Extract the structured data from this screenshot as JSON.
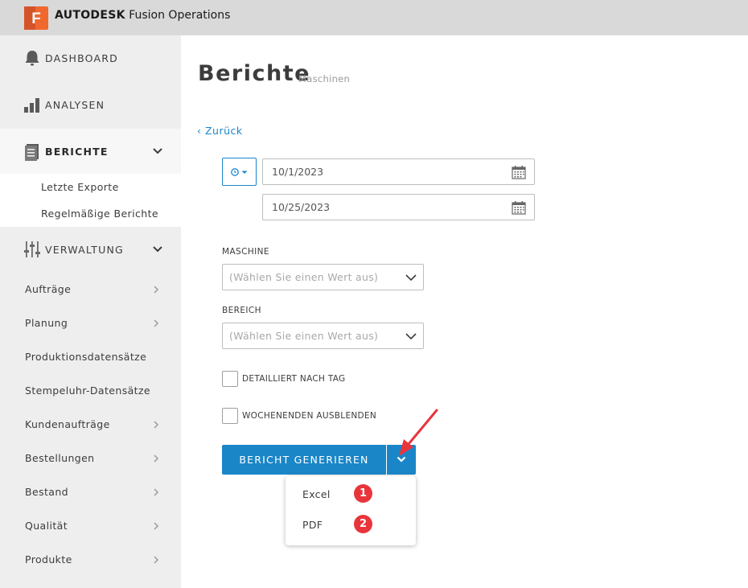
{
  "app": {
    "brand_bold": "AUTODESK",
    "brand_rest": " Fusion Operations",
    "logo_letter": "F",
    "accent_color": "#1a86c8",
    "logo_color": "#f0682d"
  },
  "sidebar": {
    "dashboard": "DASHBOARD",
    "analysen": "ANALYSEN",
    "berichte": "BERICHTE",
    "berichte_sub": [
      "Letzte Exporte",
      "Regelmäßige Berichte"
    ],
    "verwaltung": "VERWALTUNG",
    "verwaltung_items": [
      "Aufträge",
      "Planung",
      "Produktionsdatensätze",
      "Stempeluhr-Datensätze",
      "Kundenaufträge",
      "Bestellungen",
      "Bestand",
      "Qualität",
      "Produkte"
    ]
  },
  "main": {
    "title": "Berichte",
    "subtitle": "Maschinen",
    "back": "‹ Zurück",
    "date_from": "10/1/2023",
    "date_to": "10/25/2023",
    "maschine_label": "MASCHINE",
    "maschine_placeholder": "(Wählen Sie einen Wert aus)",
    "bereich_label": "BEREICH",
    "bereich_placeholder": "(Wählen Sie einen Wert aus)",
    "check_detail": "DETAILLIERT NACH TAG",
    "check_weekend": "WOCHENENDEN AUSBLENDEN",
    "generate": "BERICHT GENERIEREN",
    "menu": [
      "Excel",
      "PDF"
    ],
    "badges": [
      "1",
      "2"
    ],
    "badge_color": "#e8353b"
  }
}
